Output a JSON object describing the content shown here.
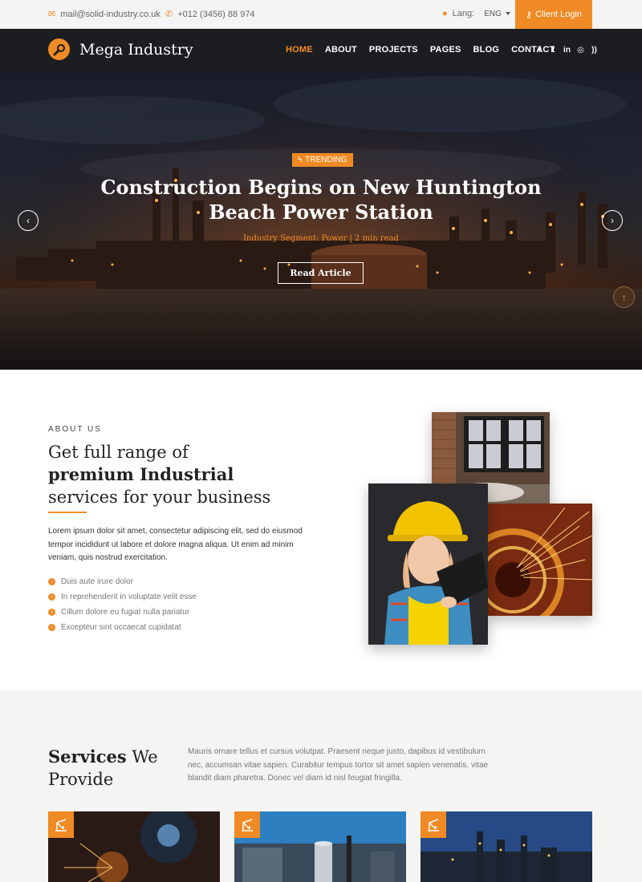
{
  "topbar": {
    "email": "mail@solid-industry.co.uk",
    "phone": "+012 (3456) 88 974",
    "lang_label": "Lang:",
    "lang_value": "ENG",
    "client_login": "Client Login"
  },
  "brand": {
    "name": "Mega Industry"
  },
  "nav": {
    "items": [
      "HOME",
      "ABOUT",
      "PROJECTS",
      "PAGES",
      "BLOG",
      "CONTACT"
    ],
    "active": "HOME"
  },
  "social": [
    "facebook",
    "twitter",
    "linkedin",
    "instagram",
    "rss"
  ],
  "hero": {
    "badge": "TRENDING",
    "title": "Construction Begins on New Huntington Beach Power Station",
    "meta": "Industry Segment: Power | 2 min read",
    "cta": "Read Article"
  },
  "about": {
    "kicker": "ABOUT US",
    "heading_line1": "Get full range of",
    "heading_line2": "premium Industrial",
    "heading_line3": "services for your business",
    "text": "Lorem ipsum dolor sit amet, consectetur adipiscing elit, sed do eiusmod tempor incididunt ut labore et dolore magna aliqua. Ut enim ad minim veniam, quis nostrud exercitation.",
    "list": [
      "Duis aute irure dolor",
      "In reprehenderit in voluptate velit esse",
      "Cillum dolore eu fugiat nulla pariatur",
      "Excepteur sint occaecat cupidatat"
    ]
  },
  "services": {
    "heading_bold": "Services",
    "heading_rest": " We",
    "heading_line2": "Provide",
    "text": "Mauris ornare tellus et cursus volutpat. Praesent neque justo, dapibus id vestibulum nec, accumsan vitae sapien. Curabitur tempus tortor sit amet sapien venenatis, vitae blandit diam pharetra. Donec vel diam id nisl feugiat fringilla."
  },
  "colors": {
    "accent": "#f08a24",
    "nav_bg": "#1c1d20",
    "services_bg": "#f4f4f2"
  }
}
